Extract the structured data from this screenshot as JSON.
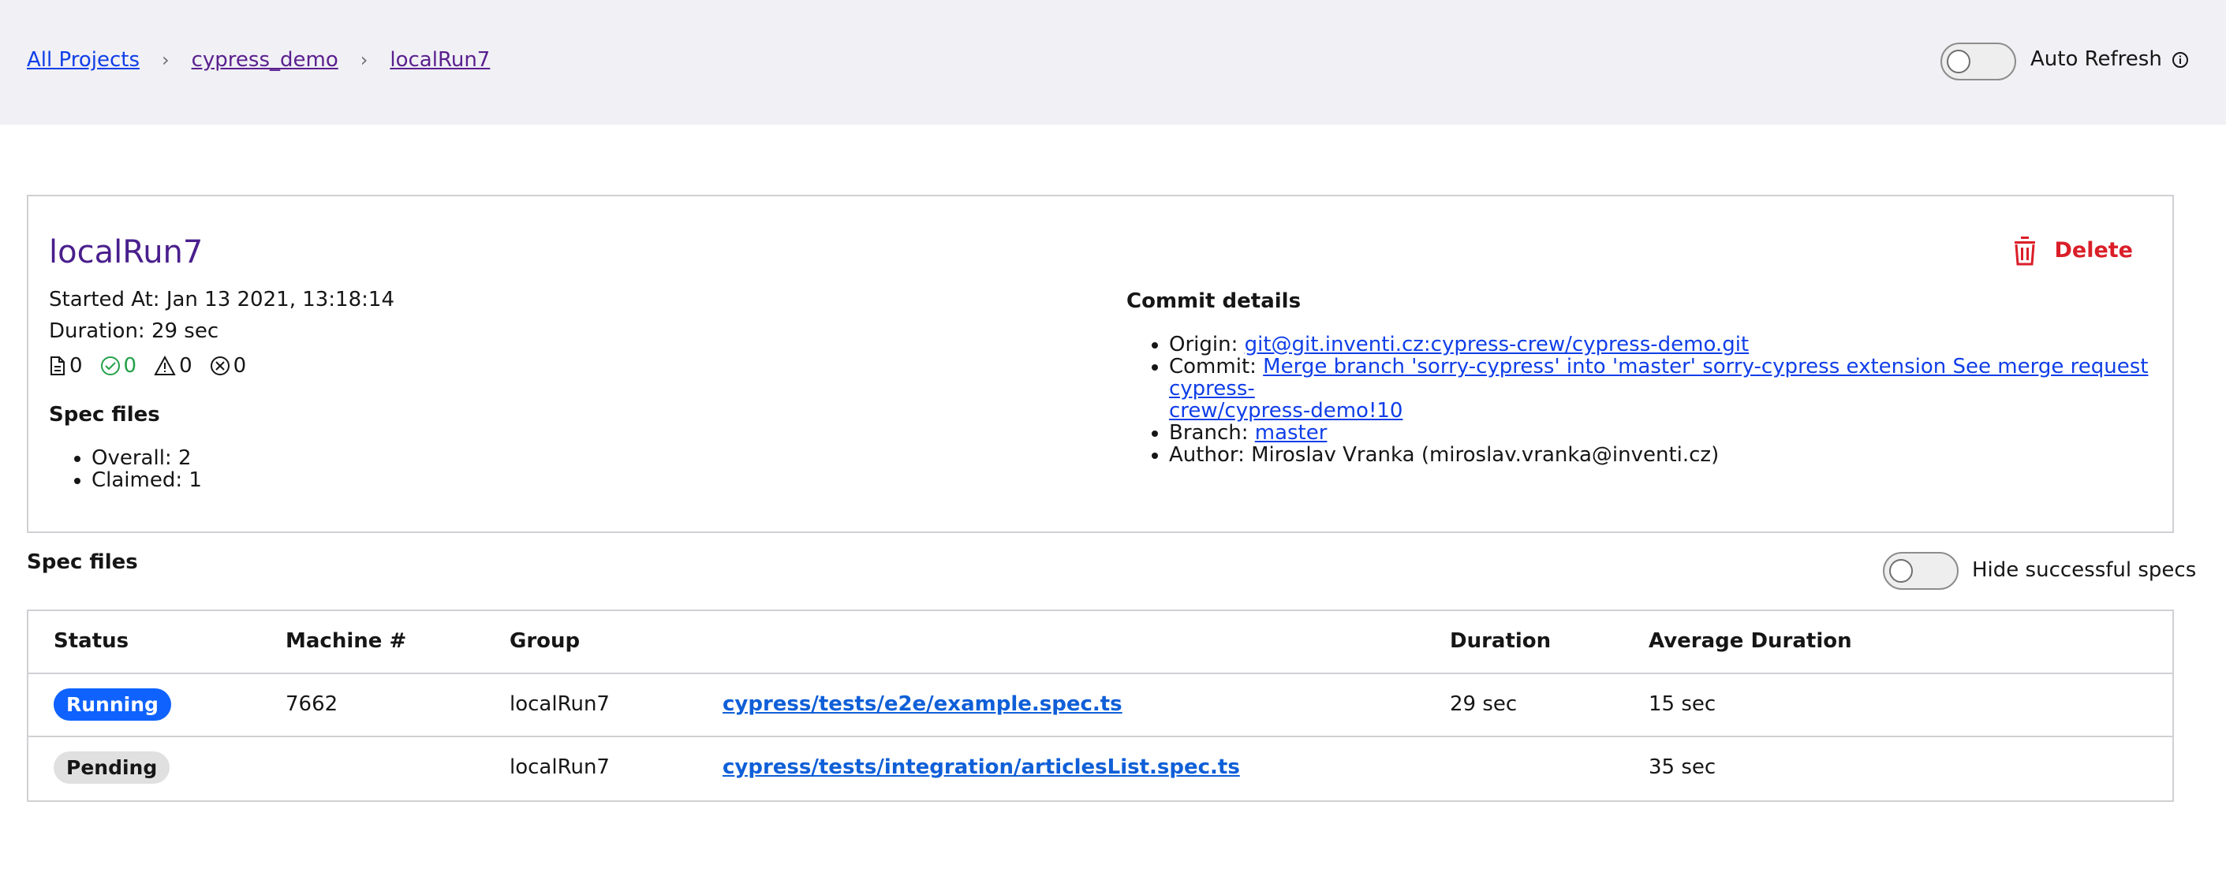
{
  "breadcrumb": {
    "items": [
      "All Projects",
      "cypress_demo",
      "localRun7"
    ],
    "separator": "›"
  },
  "header": {
    "auto_refresh_label": "Auto Refresh",
    "auto_refresh_on": false
  },
  "run": {
    "title": "localRun7",
    "started_at": "Started At: Jan 13 2021, 13:18:14",
    "duration": "Duration: 29 sec",
    "counts": {
      "files": "0",
      "passed": "0",
      "warnings": "0",
      "failed": "0"
    },
    "delete_label": "Delete",
    "spec_files_heading": "Spec files",
    "spec_files": [
      "Overall: 2",
      "Claimed: 1"
    ]
  },
  "commit": {
    "heading": "Commit details",
    "origin_label": "Origin: ",
    "origin": "git@git.inventi.cz:cypress-crew/cypress-demo.git",
    "commit_label": "Commit: ",
    "commit_line1": "Merge branch 'sorry-cypress' into 'master' sorry-cypress extension See merge request cypress-",
    "commit_line2": "crew/cypress-demo!10",
    "branch_label": "Branch: ",
    "branch": "master",
    "author": "Author: Miroslav Vranka (miroslav.vranka@inventi.cz)"
  },
  "specs": {
    "title": "Spec files",
    "hide_label": "Hide successful specs",
    "hide_on": false,
    "columns": [
      "Status",
      "Machine #",
      "Group",
      "",
      "Duration",
      "Average Duration"
    ],
    "rows": [
      {
        "status": "Running",
        "machine": "7662",
        "group": "localRun7",
        "spec": "cypress/tests/e2e/example.spec.ts",
        "duration": "29 sec",
        "avg": "15 sec"
      },
      {
        "status": "Pending",
        "machine": "",
        "group": "localRun7",
        "spec": "cypress/tests/integration/articlesList.spec.ts",
        "duration": "",
        "avg": "35 sec"
      }
    ]
  },
  "colors": {
    "header_bg": "#f0f0f5",
    "title_purple": "#4a1f8c",
    "link_blue": "#0f3ee8",
    "danger_red": "#da1e28",
    "running_blue": "#0f62fe",
    "pending_gray": "#e0e0e0"
  }
}
